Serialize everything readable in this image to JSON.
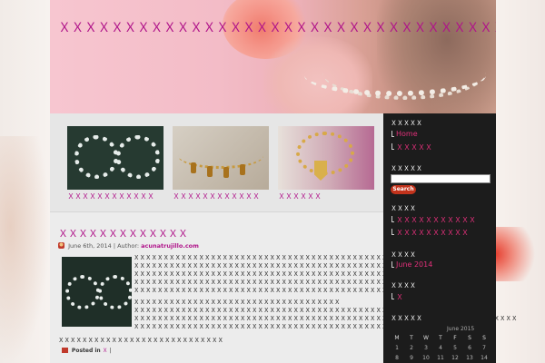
{
  "site": {
    "title": "ＸＸＸＸＸＸＸＸＸＸＸＸＸＸＸＸＸＸＸＸＸＸＸＸＸＸＸＸＸＸＸＸＸＸＸＸＸＸＸＸＸ"
  },
  "featured": [
    {
      "caption": "ＸＸＸＸＸＸＸＸＸＸＸＸ"
    },
    {
      "caption": "ＸＸＸＸＸＸＸＸＸＸＸＸ"
    },
    {
      "caption": "ＸＸＸＸＸＸ"
    }
  ],
  "post": {
    "title": "ＸＸＸＸＸＸＸＸＸＸＸＸＸ",
    "date": "June 6th, 2014",
    "author_label": "Author:",
    "author": "acunatrujillo.com",
    "paragraphs": [
      "ＸＸＸＸＸＸＸＸＸＸＸＸＸＸＸＸＸＸＸＸＸＸＸＸＸＸＸＸＸＸＸＸＸＸＸＸＸＸＸＸＸＸＸＸＸＸＸＸＸＸＸＸＸ",
      "ＸＸＸＸＸＸＸＸＸＸＸＸＸＸＸＸＸＸＸＸＸＸＸＸＸＸＸＸＸＸＸＸＸＸＸＸＸＸＸＸＸＸＸＸＸＸＸＸＸ",
      "ＸＸＸＸＸＸＸＸＸＸＸＸＸＸＸＸＸＸＸＸＸＸＸＸＸＸＸＸＸＸＸＸＸＸＸＸＸＸＸＸＸＸＸＸＸＸＸＸ",
      "ＸＸＸＸＸＸＸＸＸＸＸＸＸＸＸＸＸＸＸＸＸＸＸＸＸＸＸＸＸＸＸＸＸＸＸＸＸＸＸＸＸＸＸＸＸＸＸＸＸＸＸＸ",
      "ＸＸＸＸＸＸＸＸＸＸＸＸＸＸＸＸＸＸＸＸＸＸＸＸＸＸＸＸＸＸＸＸＸＸＸＸＸＸＸＸＸＸＸＸ",
      "ＸＸＸＸＸＸＸＸＸＸＸＸＸＸＸＸＸＸＸＸＸＸＸＸＸＸＸＸＸＸＸＸＸＸＸ",
      "ＸＸＸＸＸＸＸＸＸＸＸＸＸＸＸＸＸＸＸＸＸＸＸＸＸＸＸＸＸＸＸＸＸＸＸＸＸＸＸＸＸＸＸＸＸＸＸＸＸＸＸＸＸ",
      "ＸＸＸＸＸＸＸＸＸＸＸＸＸＸＸＸＸＸＸＸＸＸＸＸＸＸＸＸＸＸＸＸＸＸＸＸＸＸＸＸＸＸＸＸＸＸＸＸＸＸＸＸＸＸＸＸＸＸＸＸＸＸＸＸＸ",
      "ＸＸＸＸＸＸＸＸＸＸＸＸＸＸＸＸＸＸＸＸＸＸＸＸＸＸＸＸＸＸＸＸＸＸＸＸＸＸＸＸＸＸＸＸＸＸＸＸＸＸＸＸＸＸＸＸＸＸＸＸＸ"
    ],
    "tail": "ＸＸＸＸＸＸＸＸＸＸＸＸＸＸＸＸＸＸＸＸＸＸＸＸＸＸＸＸ",
    "posted_in": "Posted in",
    "category": "Ｘ",
    "separator": "|"
  },
  "sidebar": {
    "pages_title": "ＸＸＸＸＸ",
    "pages": [
      "Home",
      "ＸＸＸＸＸ"
    ],
    "search_title": "ＸＸＸＸＸ",
    "search_button": "Search",
    "categories_title": "ＸＸＸＸ",
    "categories": [
      "ＸＸＸＸＸＸＸＸＸＸＸ",
      "ＸＸＸＸＸＸＸＸＸＸ"
    ],
    "archives_title": "ＸＸＸＸ",
    "archives": [
      "June 2014"
    ],
    "meta_title": "ＸＸＸＸ",
    "meta": [
      "Ｘ"
    ],
    "calendar_title": "ＸＸＸＸＸ",
    "calendar": {
      "caption": "June 2015",
      "days": [
        "M",
        "T",
        "W",
        "T",
        "F",
        "S",
        "S"
      ],
      "rows": [
        [
          "1",
          "2",
          "3",
          "4",
          "5",
          "6",
          "7"
        ],
        [
          "8",
          "9",
          "10",
          "11",
          "12",
          "13",
          "14"
        ]
      ]
    }
  },
  "colors": {
    "link": "#b0148a",
    "sidebar_bg": "#1c1c1c",
    "accent_red": "#c2331c"
  }
}
